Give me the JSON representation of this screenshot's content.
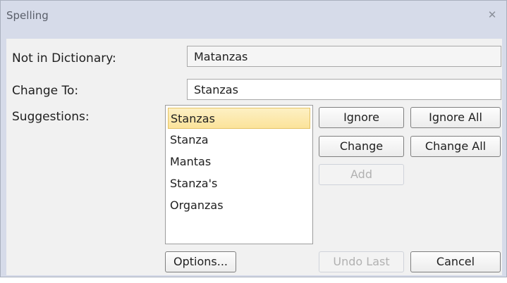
{
  "dialog": {
    "title": "Spelling",
    "close_icon": "close-icon"
  },
  "labels": {
    "not_in_dictionary": "Not in Dictionary:",
    "change_to": "Change To:",
    "suggestions": "Suggestions:"
  },
  "fields": {
    "not_in_dictionary_value": "Matanzas",
    "change_to_value": "Stanzas"
  },
  "suggestions": [
    {
      "label": "Stanzas",
      "selected": true
    },
    {
      "label": "Stanza",
      "selected": false
    },
    {
      "label": "Mantas",
      "selected": false
    },
    {
      "label": "Stanza's",
      "selected": false
    },
    {
      "label": "Organzas",
      "selected": false
    }
  ],
  "buttons": {
    "ignore": "Ignore",
    "ignore_all": "Ignore All",
    "change": "Change",
    "change_all": "Change All",
    "add": "Add",
    "options": "Options...",
    "undo_last": "Undo Last",
    "cancel": "Cancel"
  },
  "button_states": {
    "add_enabled": false,
    "undo_last_enabled": false
  },
  "colors": {
    "frame": "#d6dbe9",
    "selection": "#fbe39a"
  }
}
